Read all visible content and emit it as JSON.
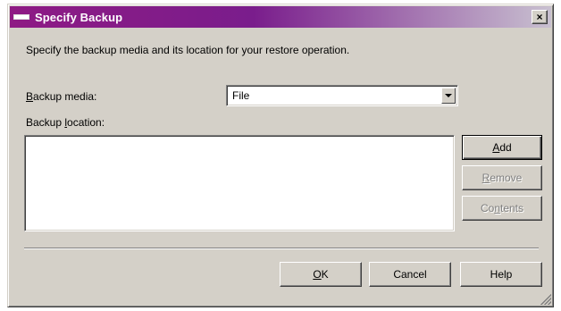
{
  "window": {
    "title": "Specify Backup",
    "close_glyph": "×"
  },
  "instruction": "Specify the backup media and its location for your restore operation.",
  "backup_media": {
    "label_mnemonic": "B",
    "label_rest": "ackup media:",
    "value": "File"
  },
  "backup_location": {
    "label_prefix": "Backup ",
    "label_mnemonic": "l",
    "label_rest": "ocation:",
    "items": []
  },
  "side_buttons": {
    "add": {
      "mnemonic": "A",
      "rest": "dd"
    },
    "remove": {
      "mnemonic": "R",
      "rest": "emove"
    },
    "contents": {
      "prefix": "Co",
      "mnemonic": "n",
      "rest": "tents"
    }
  },
  "footer_buttons": {
    "ok": {
      "mnemonic": "O",
      "rest": "K"
    },
    "cancel": "Cancel",
    "help": "Help"
  },
  "colors": {
    "title_start": "#8e1a84",
    "title_end": "#c8c0d0",
    "face": "#d4d0c8",
    "disabled_text": "#808080"
  },
  "icons": {
    "title": "window-menu-icon",
    "close": "close-icon",
    "dropdown": "chevron-down-icon",
    "grip": "resize-grip-icon"
  }
}
